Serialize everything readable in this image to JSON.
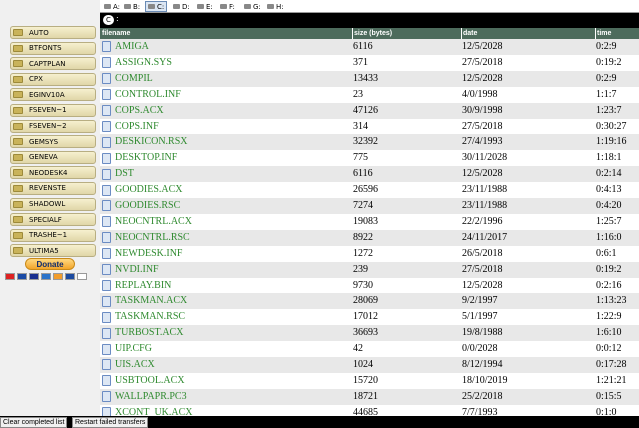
{
  "sidebar": {
    "folders": [
      "AUTO",
      "BTFONTS",
      "CAPTPLAN",
      "CPX",
      "EGINV10A",
      "FSEVEN~1",
      "FSEVEN~2",
      "GEMSYS",
      "GENEVA",
      "NEODESK4",
      "REVENSTE",
      "SHADOWL",
      "SPECIALF",
      "TRASHE~1",
      "ULTIMA5"
    ],
    "donate_label": "Donate"
  },
  "drives": [
    {
      "label": "A:",
      "selected": false
    },
    {
      "label": "B:",
      "selected": false
    },
    {
      "label": "C:",
      "selected": true
    },
    {
      "label": "D:",
      "selected": false
    },
    {
      "label": "E:",
      "selected": false
    },
    {
      "label": "F:",
      "selected": false
    },
    {
      "label": "G:",
      "selected": false
    },
    {
      "label": "H:",
      "selected": false
    }
  ],
  "path": {
    "drive": "C",
    "separator": ":"
  },
  "table": {
    "headers": {
      "filename": "filename",
      "size": "size (bytes)",
      "date": "date",
      "time": "time"
    },
    "rows": [
      {
        "name": "AMIGA",
        "size": "6116",
        "date": "12/5/2028",
        "time": "0:2:9"
      },
      {
        "name": "ASSIGN.SYS",
        "size": "371",
        "date": "27/5/2018",
        "time": "0:19:2"
      },
      {
        "name": "COMPIL",
        "size": "13433",
        "date": "12/5/2028",
        "time": "0:2:9"
      },
      {
        "name": "CONTROL.INF",
        "size": "23",
        "date": "4/0/1998",
        "time": "1:1:7"
      },
      {
        "name": "COPS.ACX",
        "size": "47126",
        "date": "30/9/1998",
        "time": "1:23:7"
      },
      {
        "name": "COPS.INF",
        "size": "314",
        "date": "27/5/2018",
        "time": "0:30:27"
      },
      {
        "name": "DESKICON.RSX",
        "size": "32392",
        "date": "27/4/1993",
        "time": "1:19:16"
      },
      {
        "name": "DESKTOP.INF",
        "size": "775",
        "date": "30/11/2028",
        "time": "1:18:1"
      },
      {
        "name": "DST",
        "size": "6116",
        "date": "12/5/2028",
        "time": "0:2:14"
      },
      {
        "name": "GOODIES.ACX",
        "size": "26596",
        "date": "23/11/1988",
        "time": "0:4:13"
      },
      {
        "name": "GOODIES.RSC",
        "size": "7274",
        "date": "23/11/1988",
        "time": "0:4:20"
      },
      {
        "name": "NEOCNTRL.ACX",
        "size": "19083",
        "date": "22/2/1996",
        "time": "1:25:7"
      },
      {
        "name": "NEOCNTRL.RSC",
        "size": "8922",
        "date": "24/11/2017",
        "time": "1:16:0"
      },
      {
        "name": "NEWDESK.INF",
        "size": "1272",
        "date": "26/5/2018",
        "time": "0:6:1"
      },
      {
        "name": "NVDI.INF",
        "size": "239",
        "date": "27/5/2018",
        "time": "0:19:2"
      },
      {
        "name": "REPLAY.BIN",
        "size": "9730",
        "date": "12/5/2028",
        "time": "0:2:16"
      },
      {
        "name": "TASKMAN.ACX",
        "size": "28069",
        "date": "9/2/1997",
        "time": "1:13:23"
      },
      {
        "name": "TASKMAN.RSC",
        "size": "17012",
        "date": "5/1/1997",
        "time": "1:22:9"
      },
      {
        "name": "TURBOST.ACX",
        "size": "36693",
        "date": "19/8/1988",
        "time": "1:6:10"
      },
      {
        "name": "UIP.CFG",
        "size": "42",
        "date": "0/0/2028",
        "time": "0:0:12"
      },
      {
        "name": "UIS.ACX",
        "size": "1024",
        "date": "8/12/1994",
        "time": "0:17:28"
      },
      {
        "name": "USBTOOL.ACX",
        "size": "15720",
        "date": "18/10/2019",
        "time": "1:21:21"
      },
      {
        "name": "WALLPAPR.PC3",
        "size": "18721",
        "date": "25/2/2018",
        "time": "0:15:5"
      },
      {
        "name": "XCONT_UK.ACX",
        "size": "44685",
        "date": "7/7/1993",
        "time": "0:1:0"
      }
    ]
  },
  "footer": {
    "clear_label": "Clear completed list",
    "restart_label": "Restart failed transfers"
  },
  "colors": {
    "filename_green": "#2f8a2f",
    "header_bg": "#4d6b5c"
  }
}
